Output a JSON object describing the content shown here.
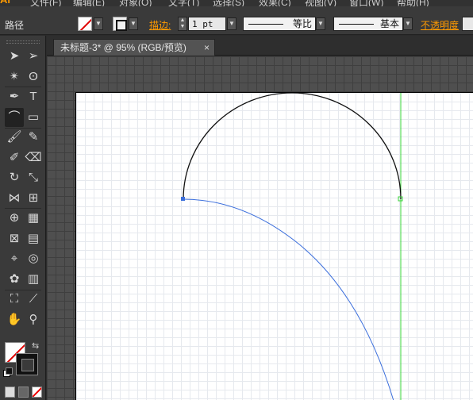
{
  "menubar": {
    "logo": "Ai",
    "items": [
      "文件(F)",
      "编辑(E)",
      "对象(O)",
      "文字(T)",
      "选择(S)",
      "效果(C)",
      "视图(V)",
      "窗口(W)",
      "帮助(H)"
    ]
  },
  "controlbar": {
    "selection_label": "路径",
    "stroke_label": "描边:",
    "stroke_weight": "1 pt",
    "variable_width_profile": "等比",
    "brush_definition": "基本",
    "opacity_label": "不透明度"
  },
  "tools": [
    {
      "name": "selection-tool",
      "glyph": "➤"
    },
    {
      "name": "direct-selection-tool",
      "glyph": "➢"
    },
    {
      "name": "magic-wand-tool",
      "glyph": "✴"
    },
    {
      "name": "lasso-tool",
      "glyph": "ʘ"
    },
    {
      "name": "pen-tool",
      "glyph": "✒"
    },
    {
      "name": "type-tool",
      "glyph": "T"
    },
    {
      "name": "arc-tool",
      "glyph": "⌒"
    },
    {
      "name": "rectangle-tool",
      "glyph": "▭"
    },
    {
      "name": "paintbrush-tool",
      "glyph": "🖌"
    },
    {
      "name": "pencil-tool",
      "glyph": "✎"
    },
    {
      "name": "blob-brush-tool",
      "glyph": "✐"
    },
    {
      "name": "eraser-tool",
      "glyph": "⌫"
    },
    {
      "name": "rotate-tool",
      "glyph": "↻"
    },
    {
      "name": "scale-tool",
      "glyph": "⤡"
    },
    {
      "name": "width-tool",
      "glyph": "⋈"
    },
    {
      "name": "free-transform-tool",
      "glyph": "⊞"
    },
    {
      "name": "shape-builder-tool",
      "glyph": "⊕"
    },
    {
      "name": "perspective-grid-tool",
      "glyph": "▦"
    },
    {
      "name": "mesh-tool",
      "glyph": "⊠"
    },
    {
      "name": "gradient-tool",
      "glyph": "▤"
    },
    {
      "name": "eyedropper-tool",
      "glyph": "⌖"
    },
    {
      "name": "blend-tool",
      "glyph": "◎"
    },
    {
      "name": "symbol-sprayer-tool",
      "glyph": "✿"
    },
    {
      "name": "column-graph-tool",
      "glyph": "▥"
    },
    {
      "name": "artboard-tool",
      "glyph": "⛶"
    },
    {
      "name": "slice-tool",
      "glyph": "⟋"
    },
    {
      "name": "hand-tool",
      "glyph": "✋"
    },
    {
      "name": "zoom-tool",
      "glyph": "⚲"
    }
  ],
  "active_tool": "arc-tool",
  "document_tab": {
    "title": "未标题-3* @ 95% (RGB/预览)",
    "close_glyph": "×"
  },
  "colors": {
    "accent_orange": "#ff9a00",
    "selection_blue": "#3c6fdc",
    "smart_guide_green": "#39d439",
    "none_swatch_red": "#e00000"
  }
}
